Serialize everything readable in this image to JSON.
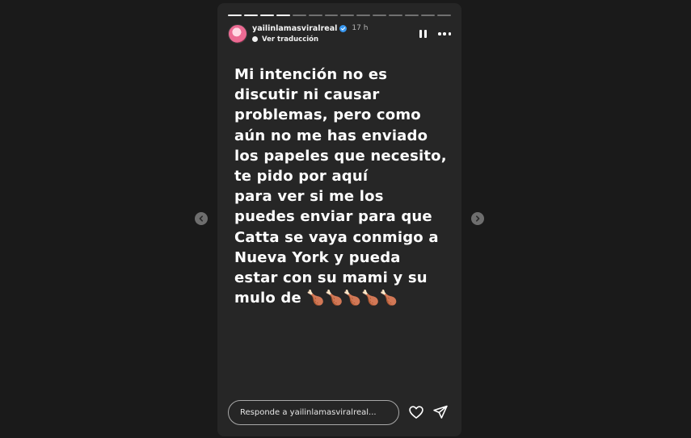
{
  "header": {
    "username": "yailinlamasviralreal",
    "time": "17 h",
    "translate_label": "Ver traducción"
  },
  "progress": {
    "total": 14,
    "completed": 4
  },
  "story": {
    "text": "Mi intención no es\ndiscutir ni causar\nproblemas, pero como\naún no me has enviado\nlos papeles que necesito,\nte pido por aquí\n para ver si me los\npuedes enviar para que\nCatta se vaya conmigo a\nNueva York y pueda\nestar con su mami y su\nmulo de 🍗🍗🍗🍗🍗"
  },
  "reply": {
    "placeholder": "Responde a yailinlamasviralreal..."
  },
  "colors": {
    "background": "#1a1a1a",
    "story_bg": "#262626",
    "verified": "#3897f0"
  },
  "icons": [
    "verified-icon",
    "globe-icon",
    "pause-icon",
    "more-options-icon",
    "heart-icon",
    "send-icon",
    "chevron-left-icon",
    "chevron-right-icon"
  ]
}
